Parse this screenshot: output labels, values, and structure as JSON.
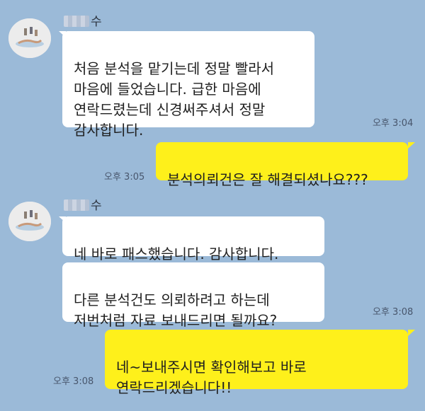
{
  "chat": {
    "messages": [
      {
        "id": "m1",
        "direction": "incoming",
        "sender_suffix": "수",
        "text": "처음 분석을 맡기는데 정말 빨라서\n마음에 들었습니다. 급한 마음에\n연락드렸는데 신경써주셔서 정말\n감사합니다.",
        "time": "오후 3:04"
      },
      {
        "id": "m2",
        "direction": "outgoing",
        "text": "분석의뢰건은 잘 해결되셨나요???",
        "time": "오후 3:05"
      },
      {
        "id": "m3",
        "direction": "incoming",
        "sender_suffix": "수",
        "text": "네  바로 패스했습니다. 감사합니다.",
        "time": ""
      },
      {
        "id": "m4",
        "direction": "incoming",
        "text": "다른 분석건도 의뢰하려고 하는데\n저번처럼 자료 보내드리면 될까요?",
        "time": "오후 3:08"
      },
      {
        "id": "m5",
        "direction": "outgoing",
        "text": "네~보내주시면 확인해보고 바로\n연락드리겠습니다!!",
        "time": "오후 3:08"
      }
    ]
  },
  "colors": {
    "background": "#9bbad8",
    "incoming_bubble": "#ffffff",
    "outgoing_bubble": "#fef01b",
    "time_text": "#48566c"
  },
  "icons": {
    "avatar": "profile-avatar-icon"
  }
}
